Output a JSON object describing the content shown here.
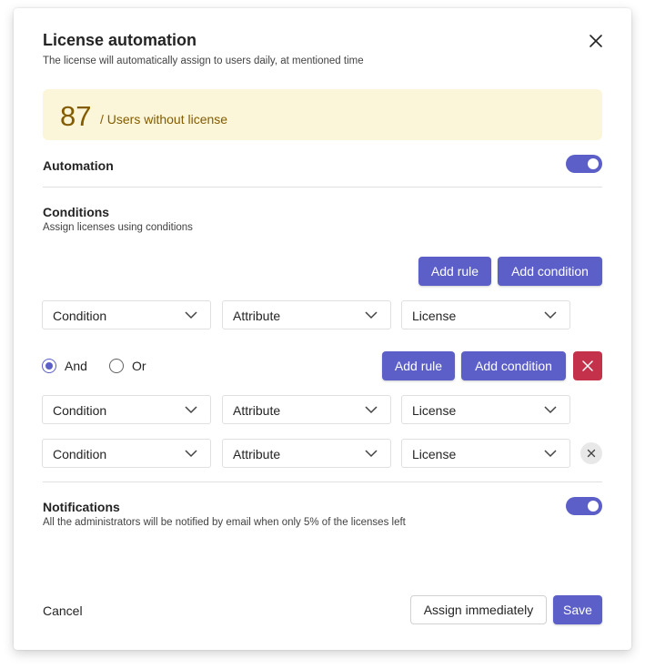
{
  "dialog": {
    "title": "License automation",
    "subtitle": "The license will automatically assign to users daily, at mentioned time"
  },
  "banner": {
    "count": "87",
    "label": "/ Users without license"
  },
  "automation": {
    "label": "Automation",
    "enabled": true
  },
  "conditions": {
    "title": "Conditions",
    "subtitle": "Assign licenses using conditions",
    "add_rule_label": "Add rule",
    "add_condition_label": "Add condition",
    "row1": {
      "condition": "Condition",
      "attribute": "Attribute",
      "license": "License"
    },
    "group": {
      "and_label": "And",
      "or_label": "Or",
      "selected": "And",
      "add_rule_label": "Add rule",
      "add_condition_label": "Add condition",
      "row2": {
        "condition": "Condition",
        "attribute": "Attribute",
        "license": "License"
      },
      "row3": {
        "condition": "Condition",
        "attribute": "Attribute",
        "license": "License"
      }
    }
  },
  "notifications": {
    "title": "Notifications",
    "subtitle": "All the administrators will be notified by email when only 5% of the licenses left",
    "enabled": true
  },
  "footer": {
    "cancel_label": "Cancel",
    "assign_label": "Assign immediately",
    "save_label": "Save"
  },
  "colors": {
    "brand": "#5b5fc7",
    "danger": "#c4314b",
    "banner_bg": "#fbf6d9",
    "banner_text": "#835b00"
  },
  "icons": {
    "close": "close-icon",
    "chevron": "chevron-down-icon",
    "delete": "delete-x-icon"
  }
}
